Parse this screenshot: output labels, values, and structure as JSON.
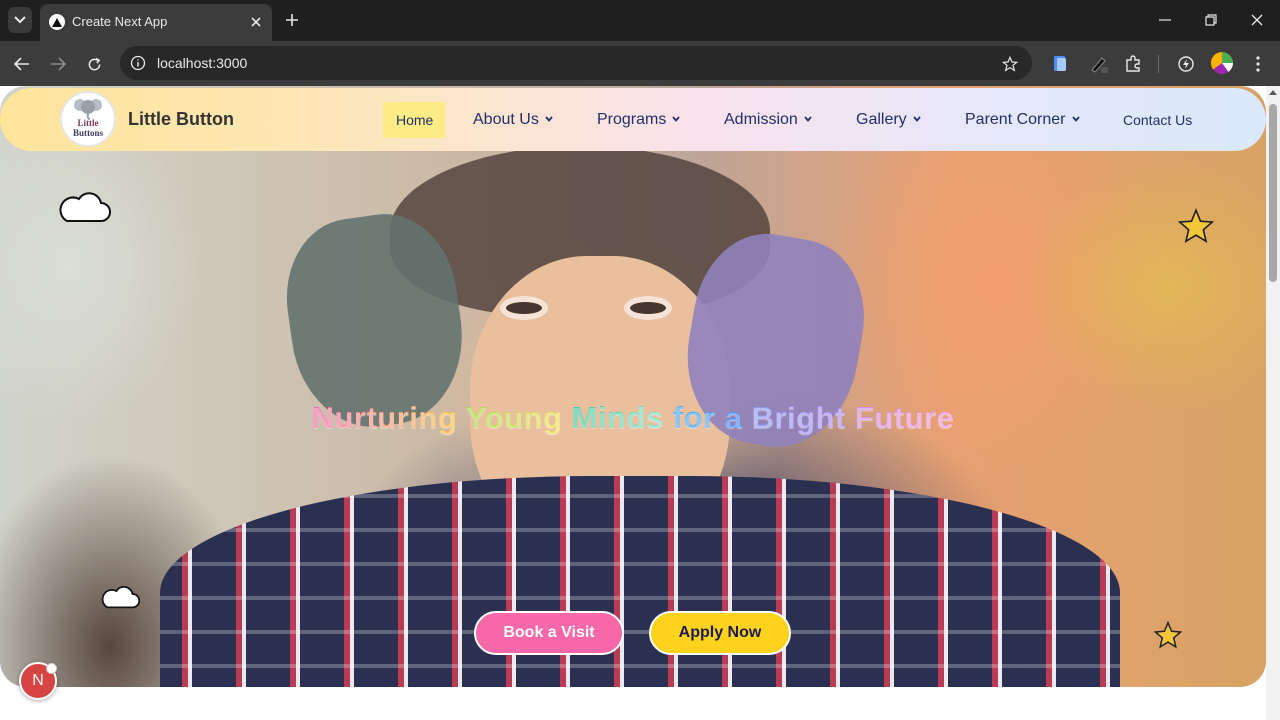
{
  "browser": {
    "tab_title": "Create Next App",
    "url": "localhost:3000"
  },
  "navbar": {
    "brand": "Little Button",
    "logo_text_line1": "Little",
    "logo_text_line2": "Buttons",
    "items": [
      {
        "label": "Home",
        "has_dropdown": false,
        "active": true
      },
      {
        "label": "About Us",
        "has_dropdown": true
      },
      {
        "label": "Programs",
        "has_dropdown": true
      },
      {
        "label": "Admission",
        "has_dropdown": true
      },
      {
        "label": "Gallery",
        "has_dropdown": true
      },
      {
        "label": "Parent Corner",
        "has_dropdown": true
      },
      {
        "label": "Contact Us",
        "has_dropdown": false
      }
    ]
  },
  "hero": {
    "title_words": [
      {
        "text": "Nurturing",
        "color": "#f06aa8",
        "color2": "#f7c44a"
      },
      {
        "text": "Young",
        "color": "#a8d84a",
        "color2": "#f0e05a"
      },
      {
        "text": "Minds",
        "color": "#3cc8a0",
        "color2": "#8ee0c8"
      },
      {
        "text": "for",
        "color": "#4aa8f0",
        "color2": "#4aa8f0"
      },
      {
        "text": "a",
        "color": "#4a8ef0",
        "color2": "#4a8ef0"
      },
      {
        "text": "Bright",
        "color": "#8e9cf0",
        "color2": "#b08ef0"
      },
      {
        "text": "Future",
        "color": "#d08ee0",
        "color2": "#f09ad8"
      }
    ],
    "book_visit_label": "Book a Visit",
    "apply_now_label": "Apply Now"
  },
  "dev_badge": {
    "label": "N"
  },
  "colors": {
    "accent_pink": "#f768a9",
    "accent_yellow": "#ffd21e",
    "nav_text": "#23306a"
  }
}
